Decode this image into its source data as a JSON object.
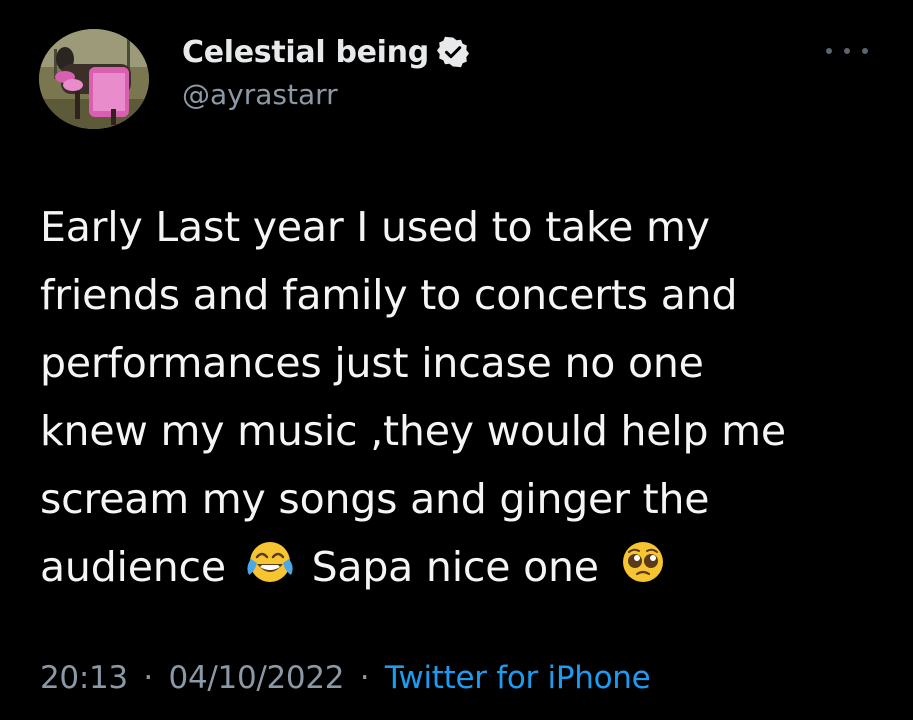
{
  "author": {
    "display_name": "Celestial being",
    "handle": "@ayrastarr",
    "verified": true,
    "avatar_icon": "goat-in-pink-costume-avatar"
  },
  "tweet": {
    "lines": [
      "Early Last year I used to take my",
      "friends and family to concerts and",
      "performances just incase no one",
      "knew my music ,they would help me",
      "scream my songs and ginger the"
    ],
    "last_line_part1": "audience",
    "emoji_1": "face-with-tears-of-joy",
    "last_line_part2": "Sapa nice one",
    "emoji_2": "pleading-face"
  },
  "meta": {
    "time": "20:13",
    "separator": "·",
    "date": "04/10/2022",
    "source": "Twitter for iPhone"
  },
  "colors": {
    "background": "#000000",
    "primary_text": "#e7e9ea",
    "secondary_text": "#8b98a5",
    "link": "#1d9bf0"
  },
  "icons": {
    "more": "more-options-icon",
    "verified": "verified-badge-icon"
  }
}
